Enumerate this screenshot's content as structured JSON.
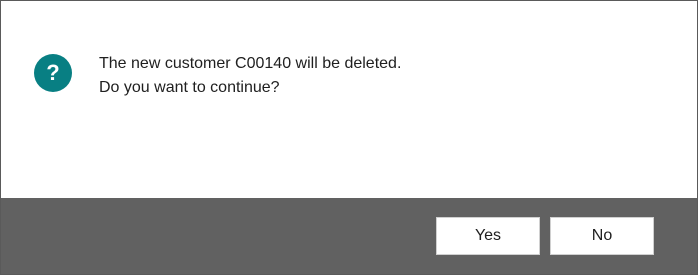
{
  "dialog": {
    "icon": "question-icon",
    "icon_glyph": "?",
    "icon_color": "#087f83",
    "message_line1": "The new customer C00140 will be deleted.",
    "message_line2": "Do you want to continue?"
  },
  "buttons": {
    "yes_label": "Yes",
    "no_label": "No"
  },
  "colors": {
    "footer_background": "#616161"
  }
}
